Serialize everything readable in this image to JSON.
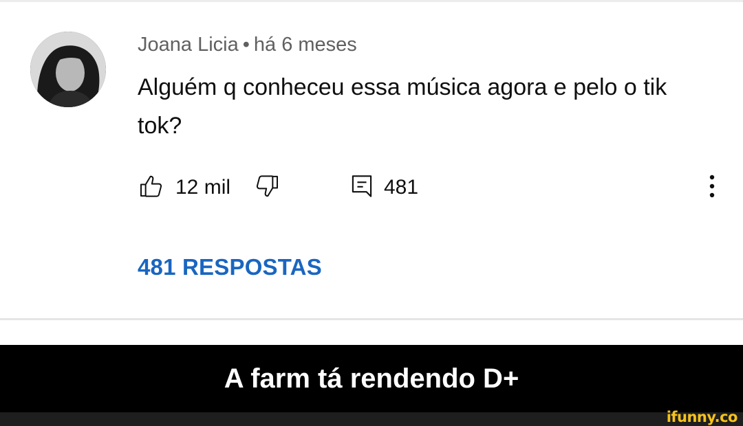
{
  "comment": {
    "author": "Joana Licia",
    "separator": "•",
    "time": "há 6 meses",
    "text": "Alguém q conheceu essa música agora e pelo o tik tok?",
    "like_count": "12 mil",
    "reply_count": "481",
    "replies_link": "481 RESPOSTAS"
  },
  "icons": {
    "like": "thumbs-up-icon",
    "dislike": "thumbs-down-icon",
    "reply": "comment-icon",
    "more": "more-vertical-icon"
  },
  "caption": "A farm tá rendendo D+",
  "watermark": "ifunny.co",
  "colors": {
    "link": "#1a66c0",
    "meta": "#606060",
    "caption_bg": "#000000",
    "watermark": "#f6c21b"
  }
}
